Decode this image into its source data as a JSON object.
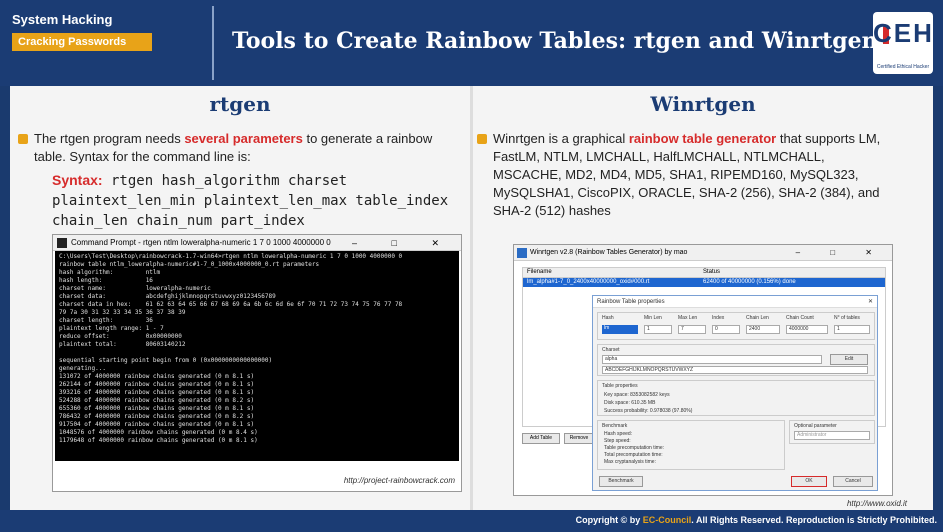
{
  "header": {
    "category": "System Hacking",
    "subcategory": "Cracking Passwords",
    "title": "Tools to Create Rainbow Tables: rtgen and Winrtgen",
    "logo_text": "CEH",
    "logo_tagline": "Certified Ethical Hacker"
  },
  "left": {
    "title": "rtgen",
    "bullet_pre": "The rtgen program needs ",
    "bullet_hl": "several parameters",
    "bullet_post": " to generate a rainbow table. Syntax for the command line is:",
    "syntax_label": "Syntax:",
    "syntax_cmd": " rtgen hash_algorithm charset plaintext_len_min plaintext_len_max table_index chain_len chain_num part_index",
    "cmd_title": "Command Prompt - rtgen ntlm loweralpha-numeric 1 7 0 1000 4000000 0",
    "cmd_btns": "– □ ✕",
    "cmd_output": "C:\\Users\\Test\\Desktop\\rainbowcrack-1.7-win64>rtgen ntlm loweralpha-numeric 1 7 0 1000 4000000 0\nrainbow table ntlm_loweralpha-numeric#1-7_0_1000x4000000_0.rt parameters\nhash algorithm:         ntlm\nhash length:            16\ncharset name:           loweralpha-numeric\ncharset data:           abcdefghijklmnopqrstuvwxyz0123456789\ncharset data in hex:    61 62 63 64 65 66 67 68 69 6a 6b 6c 6d 6e 6f 70 71 72 73 74 75 76 77 78\n79 7a 30 31 32 33 34 35 36 37 38 39\ncharset length:         36\nplaintext length range: 1 - 7\nreduce offset:          0x00000000\nplaintext total:        80603140212\n\nsequential starting point begin from 0 (0x0000000000000000)\ngenerating...\n131072 of 4000000 rainbow chains generated (0 m 8.1 s)\n262144 of 4000000 rainbow chains generated (0 m 8.1 s)\n393216 of 4000000 rainbow chains generated (0 m 8.1 s)\n524288 of 4000000 rainbow chains generated (0 m 8.2 s)\n655360 of 4000000 rainbow chains generated (0 m 8.1 s)\n786432 of 4000000 rainbow chains generated (0 m 8.2 s)\n917504 of 4000000 rainbow chains generated (0 m 8.1 s)\n1048576 of 4000000 rainbow chains generated (0 m 8.4 s)\n1179648 of 4000000 rainbow chains generated (0 m 8.1 s)",
    "url": "http://project-rainbowcrack.com"
  },
  "right": {
    "title": "Winrtgen",
    "bullet_pre": "Winrtgen is a graphical ",
    "bullet_hl": "rainbow table generator",
    "bullet_post": " that supports LM, FastLM, NTLM, LMCHALL, HalfLMCHALL, NTLMCHALL, MSCACHE, MD2, MD4, MD5, SHA1, RIPEMD160, MySQL323, MySQLSHA1, CiscoPIX, ORACLE, SHA-2 (256), SHA-2 (384), and SHA-2 (512) hashes",
    "win_title": "Winrtgen v2.8 (Rainbow Tables Generator) by mao",
    "win_btns": "– □ ✕",
    "col_filename": "Filename",
    "col_status": "Status",
    "row_filename": "lm_alpha#1-7_0_2400x40000000_oxid#000.rt",
    "row_status": "62400 of 40000000 (0.156%) done",
    "dlg_title": "Rainbow Table properties",
    "dlg_close": "✕",
    "lbl_hash": "Hash",
    "lbl_minlen": "Min Len",
    "lbl_maxlen": "Max Len",
    "lbl_index": "Index",
    "lbl_chainlen": "Chain Len",
    "lbl_chaincount": "Chain Count",
    "lbl_ntables": "N° of tables",
    "val_hash": "lm",
    "val_minlen": "1",
    "val_maxlen": "7",
    "val_index": "0",
    "val_chainlen": "2400",
    "val_chaincount": "4000000",
    "val_ntables": "1",
    "lbl_charset": "Charset",
    "val_charset": "alpha",
    "btn_edit": "Edit",
    "val_charset_chars": "ABCDEFGHIJKLMNOPQRSTUVWXYZ",
    "lbl_table_props": "Table properties",
    "prop_keyspace": "Key space: 8353082582 keys",
    "prop_disk": "Disk space: 610.35 MB",
    "prop_success": "Success probability: 0.978038 (97.80%)",
    "lbl_bench": "Benchmark",
    "bench_items": [
      "Hash speed:",
      "Step speed:",
      "Table precomputation time:",
      "Total precomputation time:",
      "Max cryptanalysis time:"
    ],
    "lbl_optional": "Optional parameter",
    "val_optional": "Administrator",
    "btn_benchmark": "Benchmark",
    "btn_ok": "OK",
    "btn_cancel": "Cancel",
    "btn_addtable": "Add Table",
    "btn_remove": "Remove",
    "url": "http://www.oxid.it"
  },
  "footer": {
    "copy_pre": "Copyright © by ",
    "copy_brand": "EC-Council",
    "copy_post": ". All Rights Reserved. Reproduction is Strictly Prohibited."
  }
}
